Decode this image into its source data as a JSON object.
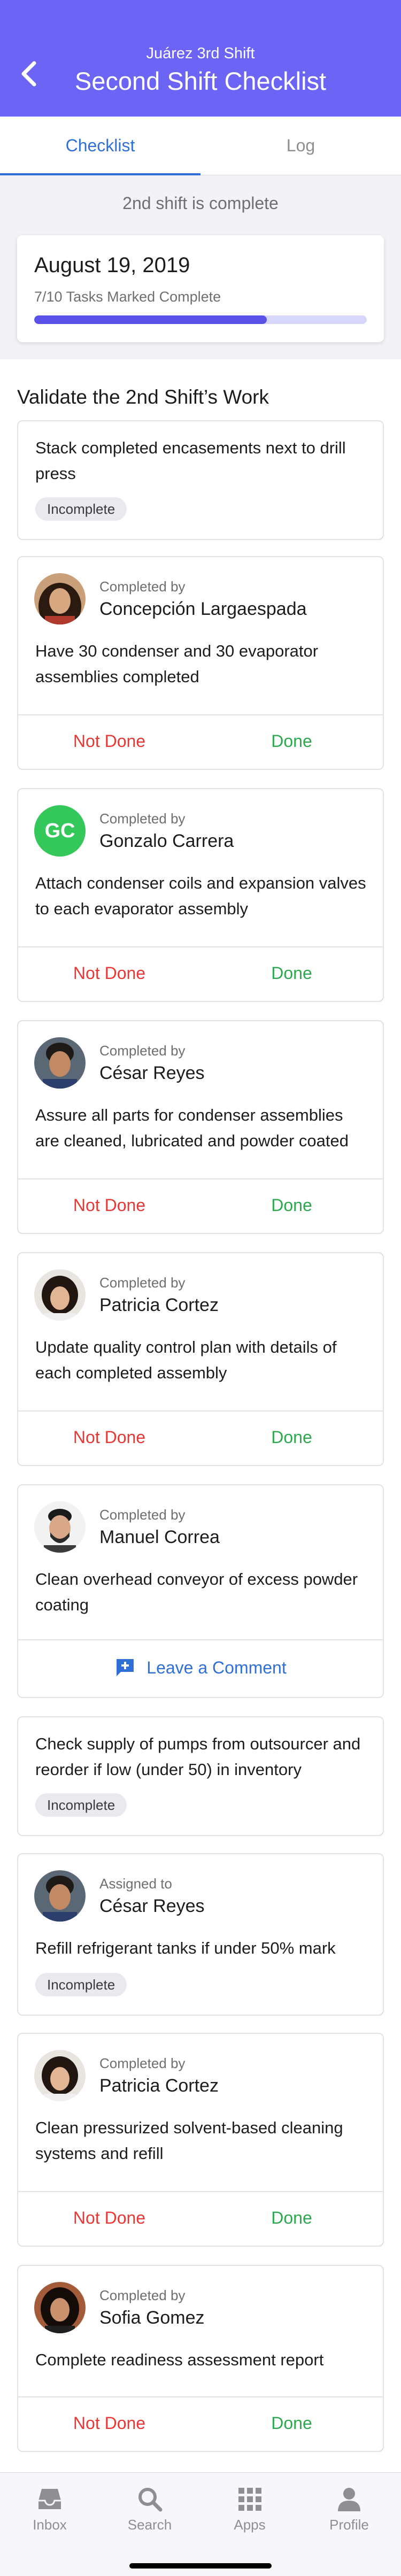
{
  "header": {
    "subtitle": "Juárez 3rd Shift",
    "title": "Second Shift Checklist",
    "back_icon": "chevron-left-icon",
    "color": "#6b64f5"
  },
  "tabs": [
    {
      "label": "Checklist",
      "active": true
    },
    {
      "label": "Log",
      "active": false
    }
  ],
  "status_text": "2nd shift is complete",
  "summary": {
    "date": "August 19, 2019",
    "tasks_text": "7/10 Tasks Marked Complete",
    "progress": 0.7
  },
  "section_title": "Validate the 2nd Shift’s Work",
  "actions": {
    "not_done": "Not Done",
    "done": "Done",
    "leave_comment": "Leave a Comment"
  },
  "tasks": [
    {
      "text": "Stack completed encasements next to drill press",
      "badge": "Incomplete"
    },
    {
      "by_label": "Completed by",
      "person": "Concepción Largaespada",
      "avatar": "photo-avatar",
      "text": "Have 30 condenser and 30 evaporator assemblies completed"
    },
    {
      "by_label": "Completed by",
      "person": "Gonzalo Carrera",
      "avatar_initials": "GC",
      "avatar_color": "#34c759",
      "text": "Attach condenser coils and expansion valves to each evaporator assembly"
    },
    {
      "by_label": "Completed by",
      "person": "César Reyes",
      "avatar": "photo-avatar",
      "text": "Assure all parts for condenser assemblies are cleaned, lubricated and powder coated"
    },
    {
      "by_label": "Completed by",
      "person": "Patricia Cortez",
      "avatar": "photo-avatar",
      "text": "Update quality control plan with details of each completed assembly"
    },
    {
      "by_label": "Completed by",
      "person": "Manuel Correa",
      "avatar": "photo-avatar",
      "text": "Clean overhead conveyor of excess powder coating"
    },
    {
      "text": "Check supply of pumps from outsourcer and reorder if low (under 50) in inventory",
      "badge": "Incomplete"
    },
    {
      "by_label": "Assigned to",
      "person": "César Reyes",
      "avatar": "photo-avatar",
      "text": "Refill refrigerant tanks if under 50% mark",
      "badge": "Incomplete"
    },
    {
      "by_label": "Completed by",
      "person": "Patricia Cortez",
      "avatar": "photo-avatar",
      "text": "Clean pressurized solvent-based cleaning systems and refill"
    },
    {
      "by_label": "Completed by",
      "person": "Sofia Gomez",
      "avatar": "photo-avatar",
      "text": "Complete readiness assessment report"
    }
  ],
  "tabbar": [
    {
      "label": "Inbox",
      "icon": "inbox-icon"
    },
    {
      "label": "Search",
      "icon": "search-icon"
    },
    {
      "label": "Apps",
      "icon": "apps-grid-icon"
    },
    {
      "label": "Profile",
      "icon": "profile-icon"
    }
  ],
  "colors": {
    "accent": "#2f6fd6",
    "not_done": "#e53935",
    "done": "#2ea84f",
    "progress_fill": "#5a52e8"
  }
}
